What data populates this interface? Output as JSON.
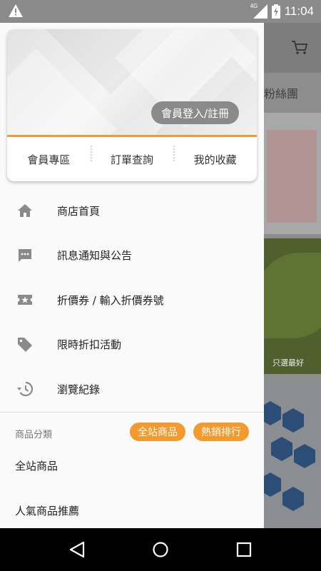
{
  "status_bar": {
    "time": "11:04",
    "network_label": "4G"
  },
  "background_app": {
    "banner_text": "粉絲團",
    "image_caption": "只選最好"
  },
  "drawer": {
    "login_button": "會員登入/註冊",
    "tabs": [
      "會員專區",
      "訂單查詢",
      "我的收藏"
    ],
    "menu": [
      {
        "icon": "home-icon",
        "label": "商店首頁"
      },
      {
        "icon": "message-icon",
        "label": "訊息通知與公告"
      },
      {
        "icon": "ticket-icon",
        "label": "折價券 / 輸入折價券號"
      },
      {
        "icon": "tag-icon",
        "label": "限時折扣活動"
      },
      {
        "icon": "history-icon",
        "label": "瀏覽紀錄"
      }
    ],
    "category_section": {
      "title": "商品分類",
      "pills": [
        "全站商品",
        "熱銷排行"
      ],
      "items": [
        "全站商品",
        "人氣商品推薦"
      ]
    }
  },
  "colors": {
    "accent": "#f39a2e",
    "login_button_bg": "#8a8a8a",
    "icon_gray": "#8a8a8a"
  }
}
